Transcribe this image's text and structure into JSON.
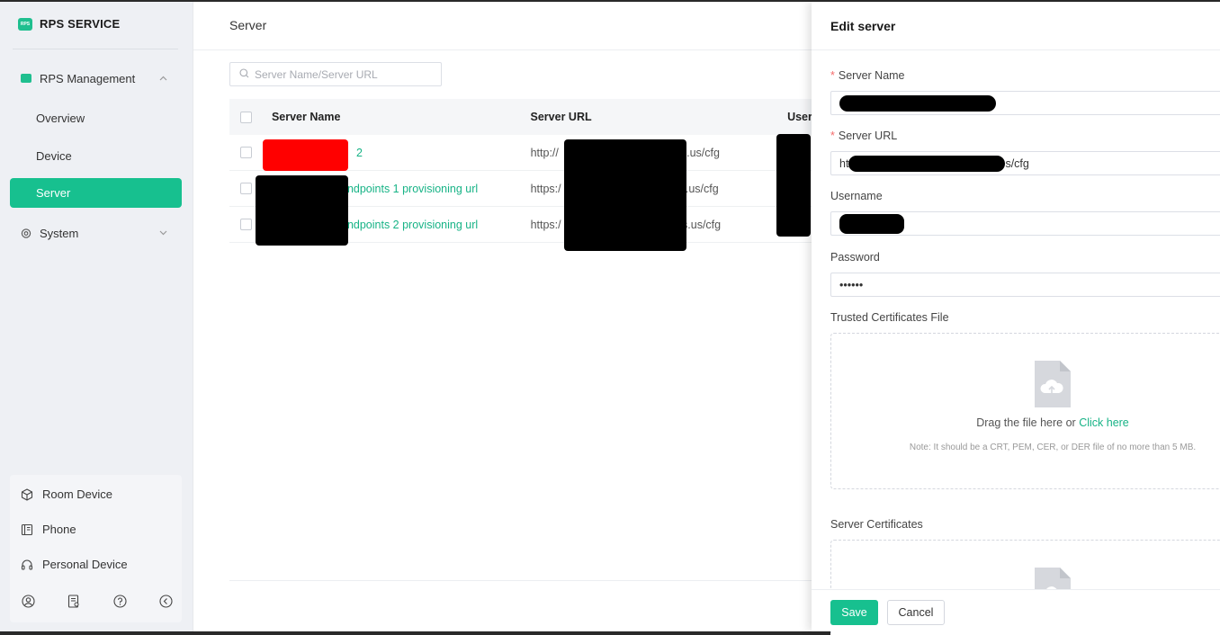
{
  "app": {
    "brand_title": "RPS SERVICE",
    "brand_logo_text": "RPS"
  },
  "sidebar": {
    "group_rps": {
      "label": "RPS Management",
      "icon": "rps-icon",
      "chevron": "⌃"
    },
    "items": [
      {
        "label": "Overview"
      },
      {
        "label": "Device"
      },
      {
        "label": "Server",
        "active": true
      }
    ],
    "group_system": {
      "label": "System",
      "icon": "gear-icon",
      "chevron": "⌄"
    },
    "bottom_items": [
      {
        "label": "Room Device",
        "icon": "cube-icon"
      },
      {
        "label": "Phone",
        "icon": "phone-book-icon"
      },
      {
        "label": "Personal Device",
        "icon": "headset-icon"
      }
    ],
    "bottom_icons": [
      "user-circle-icon",
      "document-settings-icon",
      "help-icon",
      "collapse-icon"
    ]
  },
  "main": {
    "page_title": "Server",
    "search": {
      "placeholder": "Server Name/Server URL"
    },
    "table": {
      "headers": [
        "Server Name",
        "Server URL",
        "User"
      ],
      "rows": [
        {
          "name": "2",
          "url": "http://",
          "url_tail": "s.us/cfg"
        },
        {
          "name": "ndpoints 1 provisioning url",
          "url": "https:/",
          "url_tail": "s.us/cfg"
        },
        {
          "name": "ndpoints 2 provisioning url",
          "url": "https:/",
          "url_tail": "ms.us/cfg"
        }
      ]
    }
  },
  "drawer": {
    "title": "Edit server",
    "server_name_label": "Server Name",
    "server_url_label": "Server URL",
    "server_url_prefix": "ht",
    "server_url_suffix": "s/cfg",
    "username_label": "Username",
    "password_label": "Password",
    "password_value": "••••••",
    "trusted_label": "Trusted Certificates File",
    "drop_text": "Drag the file here or",
    "drop_link": "Click here",
    "drop_note": "Note: It should be a CRT, PEM, CER, or DER file of no more than 5 MB.",
    "server_cert_label": "Server Certificates",
    "save": "Save",
    "cancel": "Cancel"
  },
  "colors": {
    "accent": "#17c08f",
    "required": "#f56c6c",
    "redaction": "#000000",
    "redaction_red": "#ff0000"
  }
}
